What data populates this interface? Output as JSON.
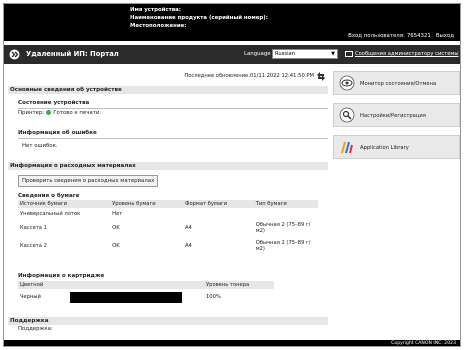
{
  "device": {
    "name_label": "Имя устройства:",
    "product_label": "Наименование продукта (серийный номер):",
    "location_label": "Местоположение:"
  },
  "user": {
    "label": "Вход пользователя:",
    "id": "7654321",
    "logout": "Выход"
  },
  "header": {
    "title": "Удаленный ИП: Портал",
    "language_label": "Language",
    "language_value": "Russian",
    "admin_mail": "Сообщения администратору системы"
  },
  "main": {
    "last_updated": "Последнее обновление:01/11 2022 12:41:50 PM",
    "basic_info": {
      "title": "Основные сведения об устройстве",
      "status_title": "Состояние устройства",
      "printer_label": "Принтер:",
      "printer_status": "Готово к печати.",
      "error_title": "Информация об ошибке",
      "error_text": "Нет ошибок."
    },
    "consumables": {
      "title": "Информация о расходных материалах",
      "check_button": "Проверить сведения о расходных материалах",
      "paper_title": "Сведения о бумаге",
      "paper_columns": [
        "Источник бумаги",
        "Уровень бумаги",
        "Формат бумаги",
        "Тип бумаги"
      ],
      "paper_rows": [
        {
          "source": "Универсальный лоток",
          "level": "Нет",
          "size": "",
          "type": ""
        },
        {
          "source": "Кассета 1",
          "level": "OK",
          "size": "A4",
          "type": "Обычная 2 (75–89 г/м2)"
        },
        {
          "source": "Кассета 2",
          "level": "OK",
          "size": "A4",
          "type": "Обычная 2 (75–89 г/м2)"
        }
      ],
      "cartridge_title": "Информация о картридже",
      "cartridge_columns": [
        "Цветной",
        "",
        "Уровень тонера"
      ],
      "cartridge_rows": [
        {
          "color": "Черный",
          "level": "100%"
        }
      ]
    },
    "support": {
      "title": "Поддержка",
      "label": "Поддержка:"
    }
  },
  "sidebar": {
    "items": [
      {
        "label": "Монитор состояния/Отмена",
        "icon": "eye-icon"
      },
      {
        "label": "Настройки/Регистрация",
        "icon": "settings-icon"
      },
      {
        "label": "Application Library",
        "icon": "app-library-icon"
      }
    ]
  },
  "footer": {
    "copyright": "Copyright CANON INC. 2023"
  }
}
